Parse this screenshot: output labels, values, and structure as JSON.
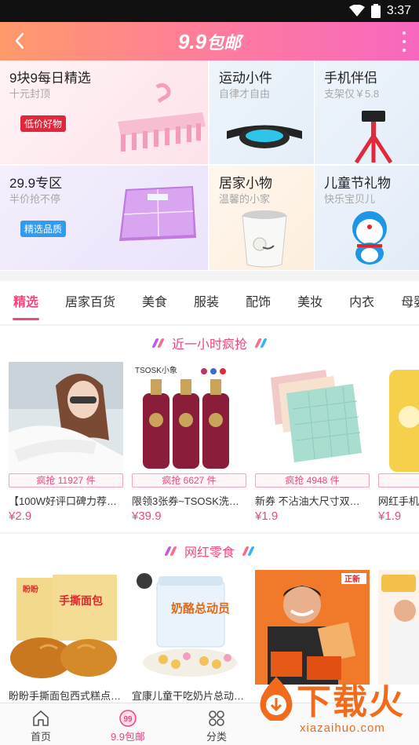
{
  "status": {
    "time": "3:37"
  },
  "header": {
    "title_num": "9.9",
    "title_text": "包邮"
  },
  "grid": [
    {
      "title": "9块9每日精选",
      "subtitle": "十元封顶",
      "badge": "低价好物",
      "badge_color": "#e0283c"
    },
    {
      "title": "运动小件",
      "subtitle": "自律才自由"
    },
    {
      "title": "手机伴侣",
      "subtitle": "支架仅￥5.8"
    },
    {
      "title": "29.9专区",
      "subtitle": "半价抢不停",
      "badge": "精选品质",
      "badge_color": "#2f9cf2"
    },
    {
      "title": "居家小物",
      "subtitle": "温馨的小家"
    },
    {
      "title": "儿童节礼物",
      "subtitle": "快乐宝贝儿"
    }
  ],
  "tabs": [
    "精选",
    "居家百货",
    "美食",
    "服装",
    "配饰",
    "美妆",
    "内衣",
    "母婴"
  ],
  "sections": [
    {
      "title": "近一小时疯抢",
      "products": [
        {
          "sold": "疯抢 11927 件",
          "name": "【100W好评口碑力荐】…",
          "price": "¥2.9"
        },
        {
          "sold": "疯抢 6627 件",
          "name": "限领3张券~TSOSK洗发…",
          "price": "¥39.9"
        },
        {
          "sold": "疯抢 4948 件",
          "name": "新券 不沾油大尺寸双色…",
          "price": "¥1.9"
        },
        {
          "sold": "疯抢",
          "name": "网红手机",
          "price": "¥1.9"
        }
      ]
    },
    {
      "title": "网红零食",
      "products": [
        {
          "name": "盼盼手撕面包西式糕点营…"
        },
        {
          "name": "宜康儿童干吃奶片总动员…"
        }
      ]
    }
  ],
  "image_text": {
    "tsosk": "TSOSK小象",
    "milk_jar": "奶酪总动员",
    "bread": "手撕面包",
    "panpan": "盼盼",
    "zhengxin": "正新"
  },
  "bottom_nav": [
    {
      "label": "首页",
      "icon": "home-icon"
    },
    {
      "label": "9.9包邮",
      "icon": "nine-nine-icon"
    },
    {
      "label": "分类",
      "icon": "category-icon"
    }
  ],
  "watermark": {
    "brand": "下载火",
    "url": "xiazaihuo.com"
  },
  "colors": {
    "accent": "#f0477c",
    "header_start": "#ff9a6a",
    "header_end": "#f767c0"
  }
}
